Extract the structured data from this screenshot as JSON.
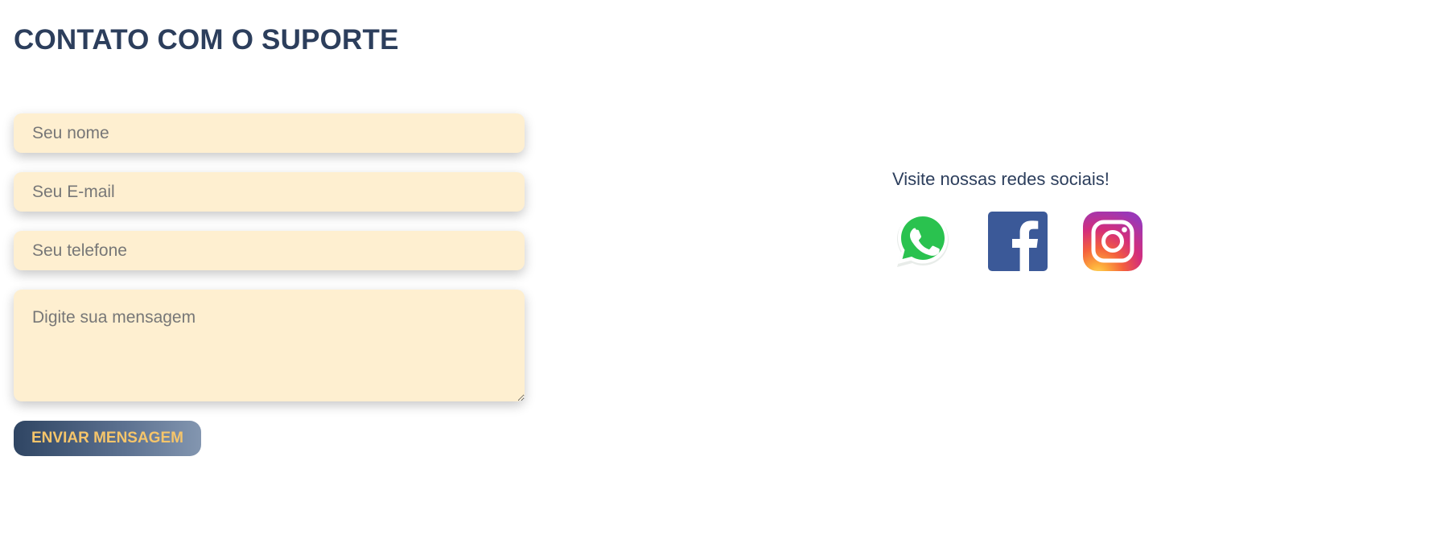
{
  "header": {
    "title": "CONTATO COM O SUPORTE"
  },
  "form": {
    "name_placeholder": "Seu nome",
    "email_placeholder": "Seu E-mail",
    "phone_placeholder": "Seu telefone",
    "message_placeholder": "Digite sua mensagem",
    "submit_label": "ENVIAR MENSAGEM"
  },
  "social": {
    "heading": "Visite nossas redes sociais!",
    "icons": [
      "whatsapp-icon",
      "facebook-icon",
      "instagram-icon"
    ]
  },
  "colors": {
    "title": "#2c3e5c",
    "field_bg": "#feefd0",
    "button_text": "#f6c56a",
    "button_gradient_start": "#2f4563",
    "button_gradient_end": "#8396b0",
    "whatsapp": "#25d366",
    "facebook": "#3b5998"
  }
}
